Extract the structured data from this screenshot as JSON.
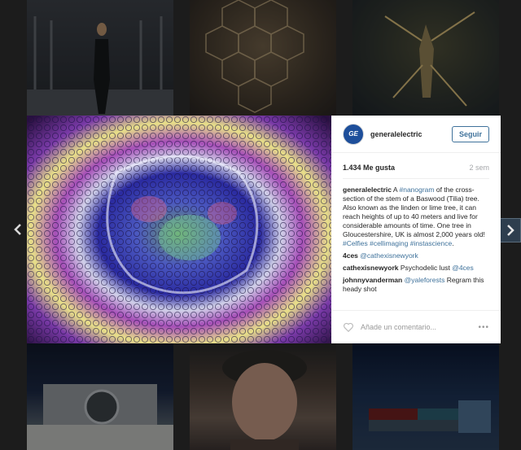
{
  "post": {
    "username": "generalelectric",
    "avatar_text": "GE",
    "follow_label": "Seguir",
    "likes": "1.434 Me gusta",
    "time": "2 sem",
    "caption": {
      "user": "generalelectric",
      "text_before": " A ",
      "tag_nanogram": "#nanogram",
      "text_after": " of the cross-section of the stem of a Baswood (Tilia) tree. Also known as the linden or lime tree, it can reach heights of up to 40 meters and live for considerable amounts of time. One tree in Gloucestershire, UK is almost 2,000 years old! ",
      "tag_celfies": "#Celfies",
      "tag_cellimaging": "#cellimaging",
      "tag_instascience": "#instascience",
      "period": "."
    },
    "comments": [
      {
        "user": "4ces",
        "mention": "@cathexisnewyork",
        "text": ""
      },
      {
        "user": "cathexisnewyork",
        "text": " Psychodelic lust ",
        "mention": "@4ces"
      },
      {
        "user": "johnnyvanderman",
        "mention": "@yaleforests",
        "text": " Regram this heady shot"
      }
    ],
    "add_comment_placeholder": "Añade un comentario...",
    "more_label": "•••"
  },
  "icons": {
    "prev": "chevron-left-icon",
    "next": "chevron-right-icon",
    "heart": "heart-icon"
  },
  "colors": {
    "link": "#3f729b",
    "muted": "#a5a7aa",
    "backdrop": "#1c1c1c"
  }
}
